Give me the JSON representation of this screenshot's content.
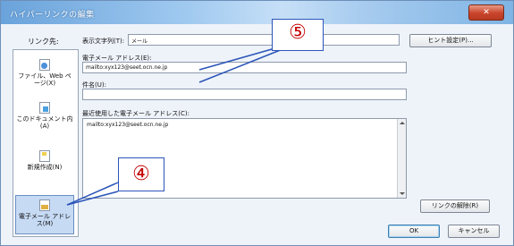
{
  "dialog": {
    "title": "ハイパーリンクの編集",
    "close_label": "✕"
  },
  "sidebar": {
    "header": "リンク先:",
    "items": [
      {
        "label": "ファイル、Web ページ(X)"
      },
      {
        "label": "このドキュメント内(A)"
      },
      {
        "label": "新規作成(N)"
      },
      {
        "label": "電子メール アドレス(M)"
      }
    ]
  },
  "form": {
    "display_text_label": "表示文字列(T):",
    "display_text_value": "メール",
    "tip_button": "ヒント設定(P)...",
    "email_label": "電子メール アドレス(E):",
    "email_value": "mailto:xyx123@seet.ocn.ne.jp",
    "subject_label": "件名(U):",
    "subject_value": "",
    "recent_label": "最近使用した電子メール アドレス(C):",
    "recent_items": [
      "mailto:xyx123@seet.ocn.ne.jp"
    ]
  },
  "buttons": {
    "remove_link": "リンクの解除(R)",
    "ok": "OK",
    "cancel": "キャンセル"
  },
  "annotations": {
    "callout_4": "④",
    "callout_5": "⑤"
  }
}
